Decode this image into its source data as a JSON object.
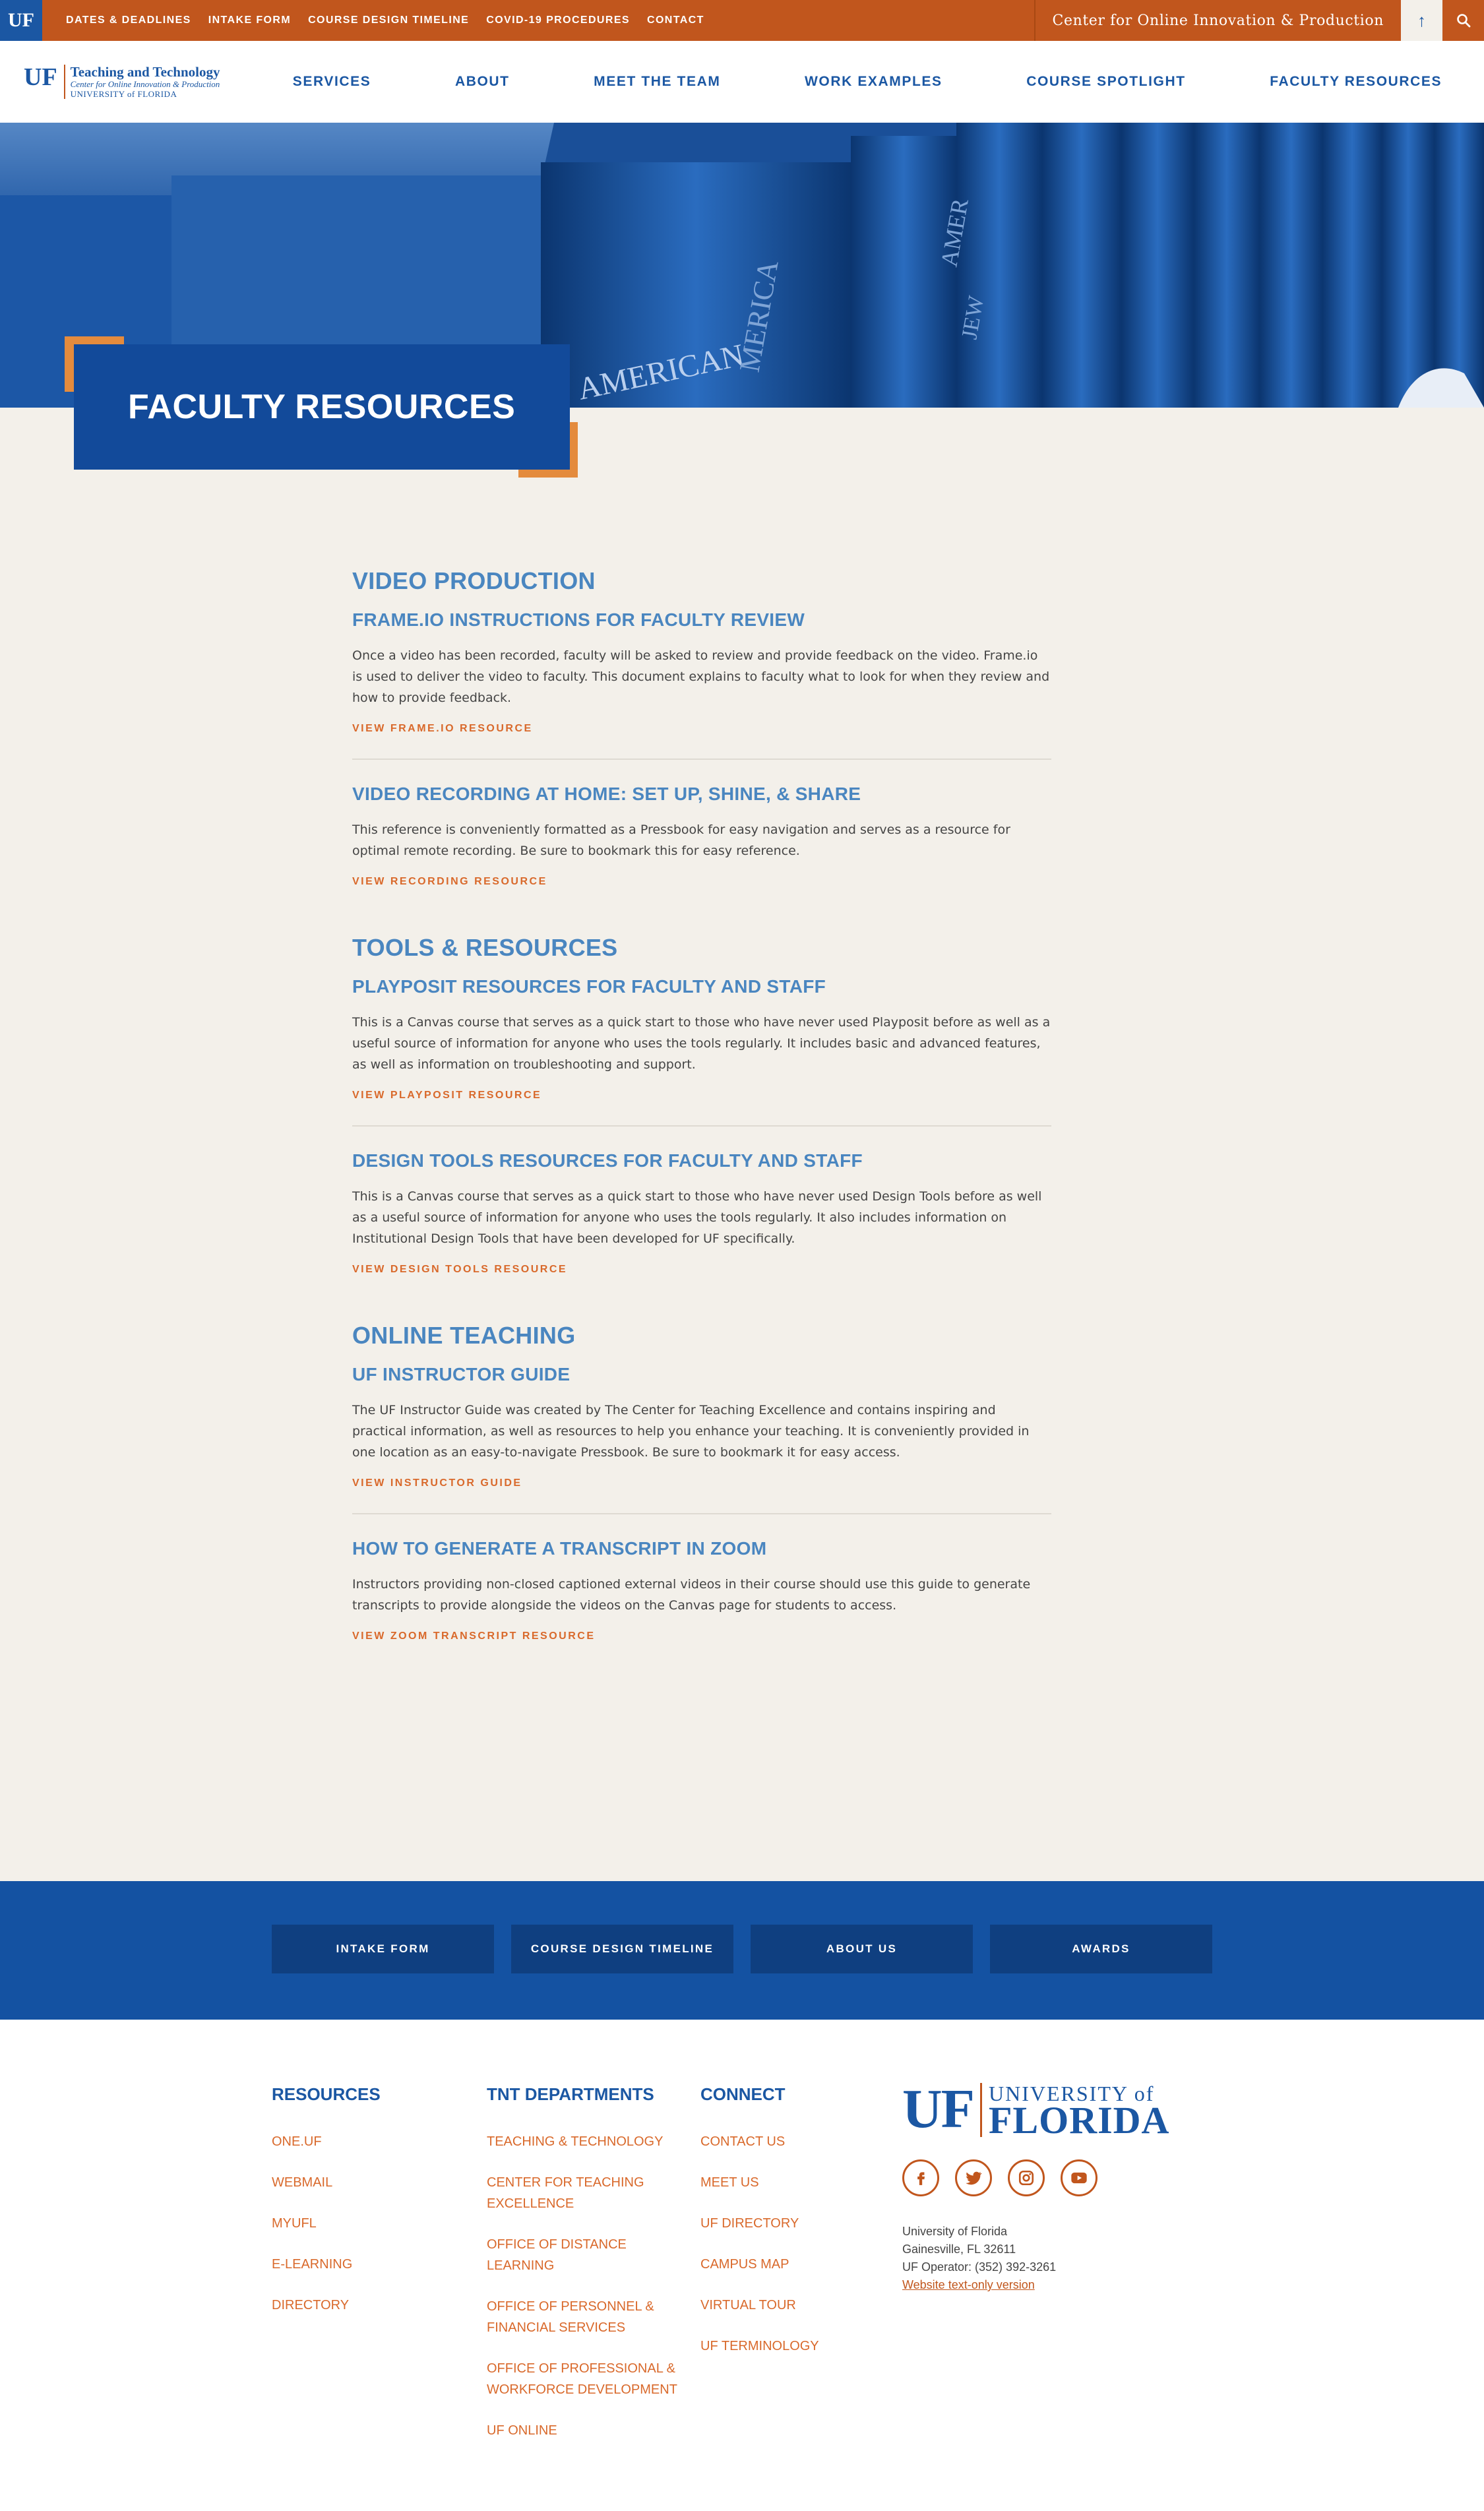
{
  "utility": {
    "badge": "UF",
    "links": [
      "DATES & DEADLINES",
      "INTAKE FORM",
      "COURSE DESIGN TIMELINE",
      "COVID-19 PROCEDURES",
      "CONTACT"
    ],
    "center_name": "Center for Online Innovation & Production",
    "up_arrow": "↑"
  },
  "logo": {
    "mark": "UF",
    "line1": "Teaching and Technology",
    "line2": "Center for Online Innovation & Production",
    "line3": "UNIVERSITY of FLORIDA"
  },
  "nav": [
    "SERVICES",
    "ABOUT",
    "MEET THE TEAM",
    "WORK EXAMPLES",
    "COURSE SPOTLIGHT",
    "FACULTY RESOURCES"
  ],
  "hero": {
    "title": "FACULTY RESOURCES",
    "spine_text": [
      "AMERICAN",
      "MERICA",
      "AMER",
      "JEW"
    ]
  },
  "sections": [
    {
      "title": "VIDEO PRODUCTION",
      "items": [
        {
          "heading": "FRAME.IO INSTRUCTIONS FOR FACULTY REVIEW",
          "body": "Once a video has been recorded, faculty will be asked to review and provide feedback on the video. Frame.io is used to deliver the video to faculty. This document explains to faculty what to look for when they review and how to provide feedback.",
          "link": "VIEW FRAME.IO RESOURCE"
        },
        {
          "heading": "VIDEO RECORDING AT HOME: SET UP, SHINE, & SHARE",
          "body": "This reference is conveniently formatted as a Pressbook for easy navigation and serves as a resource for optimal remote recording. Be sure to bookmark this for easy reference.",
          "link": "VIEW RECORDING RESOURCE"
        }
      ]
    },
    {
      "title": "TOOLS & RESOURCES",
      "items": [
        {
          "heading": "PLAYPOSIT RESOURCES FOR FACULTY AND STAFF",
          "body": "This is a Canvas course that serves as a quick start to those who have never used Playposit before as well as a useful source of information for anyone who uses the tools regularly. It includes basic and advanced features, as well as information on troubleshooting and support.",
          "link": "VIEW PLAYPOSIT RESOURCE"
        },
        {
          "heading": "DESIGN TOOLS RESOURCES FOR FACULTY AND STAFF",
          "body": "This is a Canvas course that serves as a quick start to those who have never used Design Tools before as well as a useful source of information for anyone who uses the tools regularly. It also includes information on Institutional Design Tools that have been developed for UF specifically.",
          "link": "VIEW DESIGN TOOLS RESOURCE"
        }
      ]
    },
    {
      "title": "ONLINE TEACHING",
      "items": [
        {
          "heading": "UF INSTRUCTOR GUIDE",
          "body": "The UF Instructor Guide was created by The Center for Teaching Excellence and contains inspiring and practical information, as well as resources to help you enhance your teaching.  It is conveniently provided in one location as an easy-to-navigate Pressbook. Be sure to bookmark it for easy access.",
          "link": "VIEW INSTRUCTOR GUIDE"
        },
        {
          "heading": "HOW TO GENERATE A TRANSCRIPT IN ZOOM",
          "body": "Instructors providing non-closed captioned external videos in their course should use this guide to generate transcripts to provide alongside the videos on the Canvas page for students to access.",
          "link": "VIEW ZOOM TRANSCRIPT RESOURCE"
        }
      ]
    }
  ],
  "band": [
    "INTAKE FORM",
    "COURSE DESIGN TIMELINE",
    "ABOUT US",
    "AWARDS"
  ],
  "footer": {
    "resources": {
      "title": "RESOURCES",
      "links": [
        "ONE.UF",
        "WEBMAIL",
        "MYUFL",
        "E-LEARNING",
        "DIRECTORY"
      ]
    },
    "departments": {
      "title": "TNT DEPARTMENTS",
      "links": [
        "TEACHING & TECHNOLOGY",
        "CENTER FOR TEACHING EXCELLENCE",
        "OFFICE OF DISTANCE LEARNING",
        "OFFICE OF PERSONNEL & FINANCIAL SERVICES",
        "OFFICE OF PROFESSIONAL & WORKFORCE DEVELOPMENT",
        "UF ONLINE"
      ]
    },
    "connect": {
      "title": "CONNECT",
      "links": [
        "CONTACT US",
        "MEET US",
        "UF DIRECTORY",
        "CAMPUS MAP",
        "VIRTUAL TOUR",
        "UF TERMINOLOGY"
      ]
    },
    "brand": {
      "uf": "UF",
      "univ": "UNIVERSITY of",
      "florida": "FLORIDA"
    },
    "address": {
      "line1": "University of Florida",
      "line2": "Gainesville, FL 32611",
      "line3": "UF Operator: (352) 392-3261",
      "text_only": "Website text-only version"
    }
  },
  "colors": {
    "orange": "#c1561d",
    "blue": "#1b57a3",
    "light_blue_heading": "#4a86c0",
    "link_orange": "#d9692b"
  }
}
